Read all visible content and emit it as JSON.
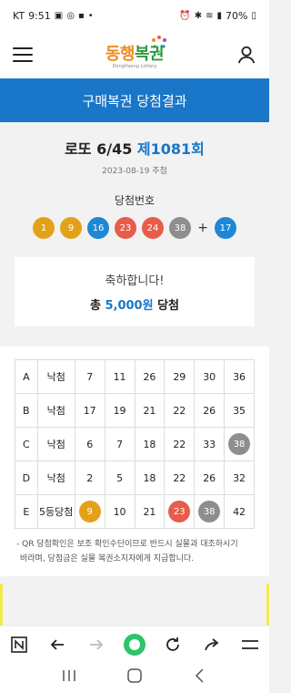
{
  "status_bar": {
    "carrier": "KT",
    "time": "9:51",
    "battery": "70%"
  },
  "header": {
    "logo_main_1": "동행",
    "logo_main_2": "복권",
    "logo_sub": "DongHaeng Lottery"
  },
  "title_bar": {
    "title": "구매복권 당첨결과"
  },
  "draw": {
    "game": "로또 6/45",
    "round": "제1081회",
    "date": "2023-08-19 추첨",
    "winning_label": "당첨번호",
    "numbers": [
      {
        "n": "1",
        "color": "#e3a11a"
      },
      {
        "n": "9",
        "color": "#e3a11a"
      },
      {
        "n": "16",
        "color": "#1e88d6"
      },
      {
        "n": "23",
        "color": "#e85c4a"
      },
      {
        "n": "24",
        "color": "#e85c4a"
      },
      {
        "n": "38",
        "color": "#8e8e8e"
      }
    ],
    "plus": "+",
    "bonus": {
      "n": "17",
      "color": "#1e88d6"
    }
  },
  "result": {
    "congrats": "축하합니다!",
    "prize_prefix": "총 ",
    "prize_amount": "5,000원",
    "prize_suffix": " 당첨"
  },
  "ticket": {
    "rows": [
      {
        "label": "A",
        "result": "낙첨",
        "nums": [
          {
            "n": "7"
          },
          {
            "n": "11"
          },
          {
            "n": "26"
          },
          {
            "n": "29"
          },
          {
            "n": "30"
          },
          {
            "n": "36"
          }
        ]
      },
      {
        "label": "B",
        "result": "낙첨",
        "nums": [
          {
            "n": "17"
          },
          {
            "n": "19"
          },
          {
            "n": "21"
          },
          {
            "n": "22"
          },
          {
            "n": "26"
          },
          {
            "n": "35"
          }
        ]
      },
      {
        "label": "C",
        "result": "낙첨",
        "nums": [
          {
            "n": "6"
          },
          {
            "n": "7"
          },
          {
            "n": "18"
          },
          {
            "n": "22"
          },
          {
            "n": "33"
          },
          {
            "n": "38",
            "color": "#8e8e8e"
          }
        ]
      },
      {
        "label": "D",
        "result": "낙첨",
        "nums": [
          {
            "n": "2"
          },
          {
            "n": "5"
          },
          {
            "n": "18"
          },
          {
            "n": "22"
          },
          {
            "n": "26"
          },
          {
            "n": "32"
          }
        ]
      },
      {
        "label": "E",
        "result": "5등당첨",
        "nums": [
          {
            "n": "9",
            "color": "#e3a11a"
          },
          {
            "n": "10"
          },
          {
            "n": "21"
          },
          {
            "n": "23",
            "color": "#e85c4a"
          },
          {
            "n": "38",
            "color": "#8e8e8e"
          },
          {
            "n": "42"
          }
        ]
      }
    ]
  },
  "notice": {
    "line1": "- QR 당첨확인은 보조 확인수단이므로 반드시 실물과 대조하시기",
    "line2": "바라며, 당첨금은 실물 복권소지자에게 지급합니다."
  },
  "toolbar": {
    "icons": [
      "n-icon",
      "back-arrow-icon",
      "forward-arrow-icon",
      "home-dot-icon",
      "refresh-icon",
      "share-icon",
      "menu-icon"
    ]
  }
}
